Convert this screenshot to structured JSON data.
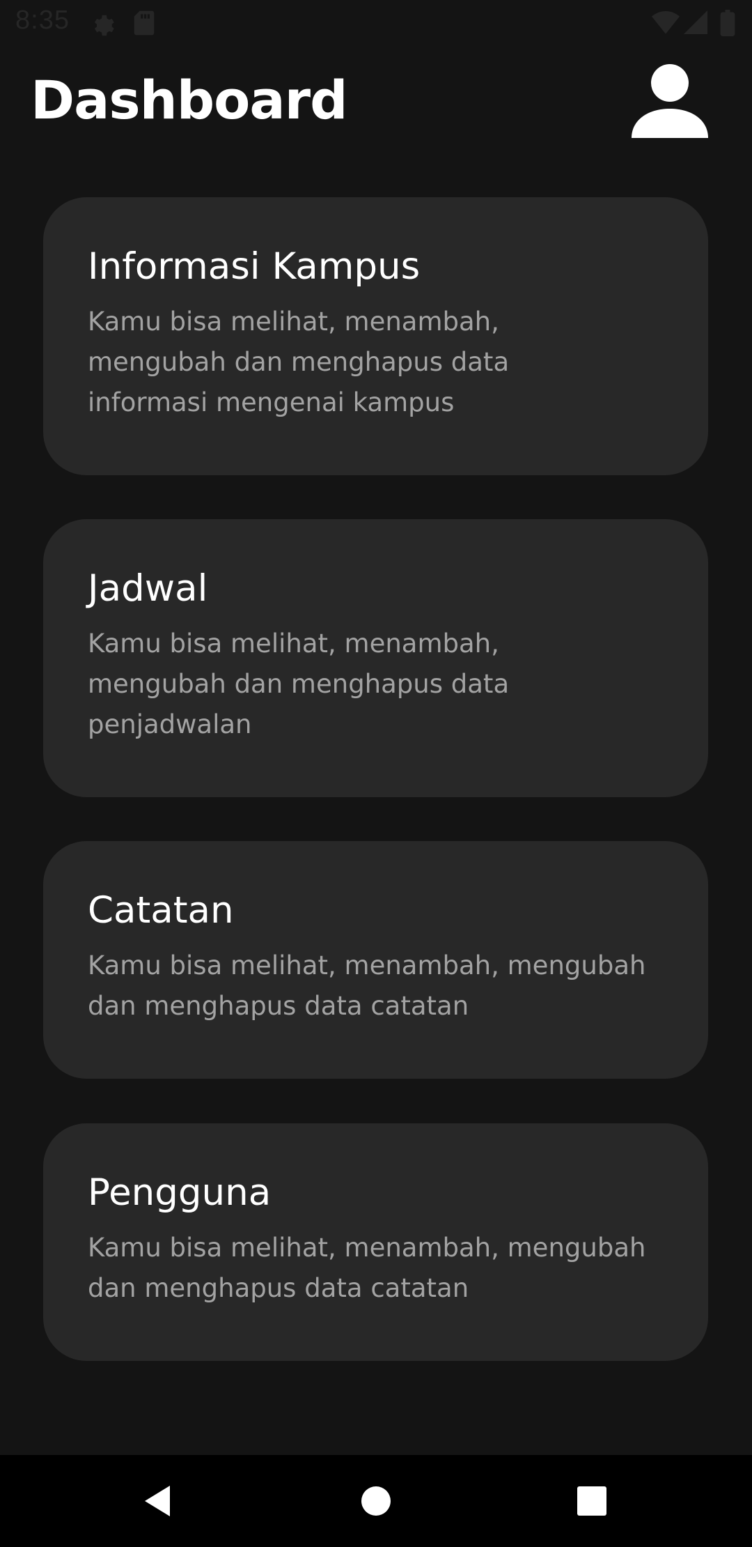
{
  "status_bar": {
    "time": "8:35",
    "icons": [
      "gear-icon",
      "sd-card-icon",
      "wifi-icon",
      "signal-icon",
      "battery-icon"
    ]
  },
  "header": {
    "title": "Dashboard",
    "avatar_icon": "person-icon"
  },
  "cards": [
    {
      "title": "Informasi Kampus",
      "description": "Kamu bisa melihat, menambah, mengubah dan menghapus data informasi mengenai kampus"
    },
    {
      "title": "Jadwal",
      "description": "Kamu bisa melihat, menambah, mengubah dan menghapus data penjadwalan"
    },
    {
      "title": "Catatan",
      "description": "Kamu bisa melihat, menambah, mengubah dan menghapus data catatan"
    },
    {
      "title": "Pengguna",
      "description": "Kamu bisa melihat, menambah, mengubah dan menghapus data catatan"
    }
  ],
  "nav_bar": {
    "icons": [
      "back-icon",
      "home-icon",
      "recents-icon"
    ]
  },
  "colors": {
    "background": "#141414",
    "card": "#282828",
    "title_text": "#ffffff",
    "description_text": "#a3a3a3"
  }
}
